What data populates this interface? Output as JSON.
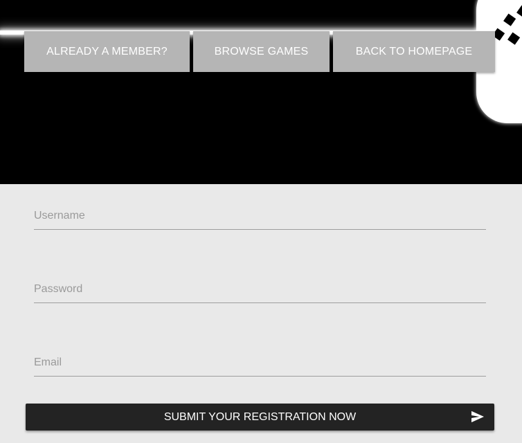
{
  "nav": {
    "items": [
      {
        "label": "ALREADY A MEMBER?"
      },
      {
        "label": "BROWSE GAMES"
      },
      {
        "label": "BACK TO HOMEPAGE"
      }
    ]
  },
  "form": {
    "username": {
      "placeholder": "Username",
      "value": ""
    },
    "password": {
      "placeholder": "Password",
      "value": ""
    },
    "email": {
      "placeholder": "Email",
      "value": ""
    },
    "submit_label": "SUBMIT YOUR REGISTRATION NOW",
    "submit_icon": "send-icon"
  },
  "colors": {
    "hero_background": "#000000",
    "nav_button": "#b5b5b5",
    "form_background": "#e9e9e9",
    "submit_button": "#232323"
  }
}
